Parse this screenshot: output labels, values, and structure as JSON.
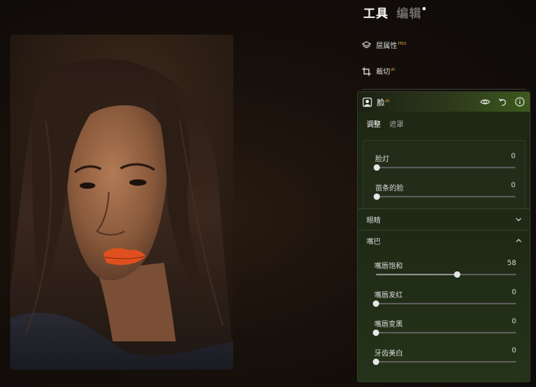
{
  "header": {
    "tabs": [
      {
        "label": "工具",
        "active": true
      },
      {
        "label": "编辑",
        "active": false
      }
    ]
  },
  "tools": [
    {
      "label": "层属性",
      "badge": "PRO",
      "icon": "layers-icon"
    },
    {
      "label": "裁切",
      "badge": "AI",
      "icon": "crop-icon"
    }
  ],
  "panel": {
    "title": "脸",
    "title_badge": "AI",
    "icons": [
      "portrait-icon",
      "eye-icon",
      "undo-icon",
      "info-icon"
    ],
    "subtabs": [
      {
        "label": "调整",
        "active": true
      },
      {
        "label": "遮罩",
        "active": false
      }
    ],
    "face_sliders": [
      {
        "label": "脸灯",
        "value": "0",
        "fraction": 0.0
      },
      {
        "label": "苗条的脸",
        "value": "0",
        "fraction": 0.0
      }
    ],
    "eyes_section": {
      "label": "眼睛",
      "icon": "chevron-down-icon"
    },
    "mouth_section": {
      "label": "嘴巴",
      "icon": "chevron-up-icon"
    },
    "mouth_sliders": [
      {
        "label": "嘴唇饱和",
        "value": "58",
        "fraction": 0.58
      },
      {
        "label": "嘴唇发红",
        "value": "0",
        "fraction": 0.0
      },
      {
        "label": "嘴唇变黑",
        "value": "0",
        "fraction": 0.0
      },
      {
        "label": "牙齿美白",
        "value": "0",
        "fraction": 0.0
      }
    ]
  },
  "colors": {
    "panel_accent": "#3d5a1c",
    "lip_color": "#e0501e",
    "pro_badge": "#d8a640"
  }
}
